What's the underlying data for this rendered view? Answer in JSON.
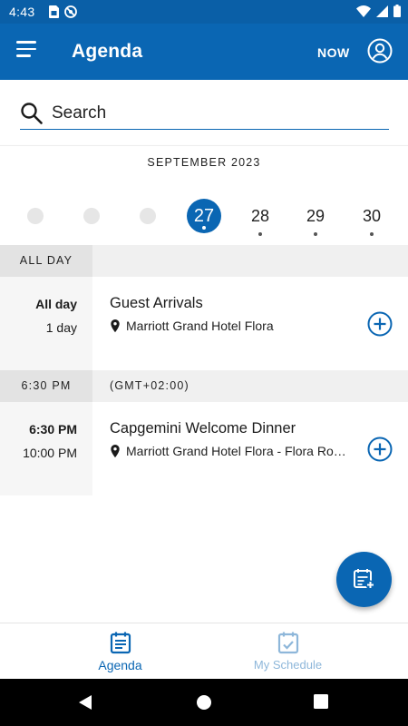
{
  "status_bar": {
    "time": "4:43"
  },
  "app_bar": {
    "title": "Agenda",
    "now_label": "NOW"
  },
  "search": {
    "placeholder": "Search"
  },
  "calendar": {
    "month": "SEPTEMBER 2023",
    "days": [
      {
        "label": "",
        "has_event": false,
        "selected": false
      },
      {
        "label": "",
        "has_event": false,
        "selected": false
      },
      {
        "label": "",
        "has_event": false,
        "selected": false
      },
      {
        "label": "27",
        "has_event": true,
        "selected": true
      },
      {
        "label": "28",
        "has_event": true,
        "selected": false
      },
      {
        "label": "29",
        "has_event": true,
        "selected": false
      },
      {
        "label": "30",
        "has_event": true,
        "selected": false
      }
    ]
  },
  "agenda": {
    "sections": [
      {
        "header_left": "ALL DAY",
        "header_right": "",
        "event": {
          "start": "All day",
          "end": "1 day",
          "title": "Guest Arrivals",
          "location": "Marriott Grand Hotel Flora"
        }
      },
      {
        "header_left": "6:30 PM",
        "header_right": "(GMT+02:00)",
        "event": {
          "start": "6:30 PM",
          "end": "10:00 PM",
          "title": "Capgemini Welcome Dinner",
          "location": "Marriott Grand Hotel Flora - Flora Ro…"
        }
      }
    ]
  },
  "bottom_nav": {
    "items": [
      {
        "label": "Agenda",
        "icon": "calendar-list-icon",
        "active": true
      },
      {
        "label": "My Schedule",
        "icon": "calendar-check-icon",
        "active": false
      }
    ]
  },
  "colors": {
    "primary": "#0a66b3",
    "status_bar": "#0a5fa7",
    "inactive_nav": "#8eb7da"
  }
}
